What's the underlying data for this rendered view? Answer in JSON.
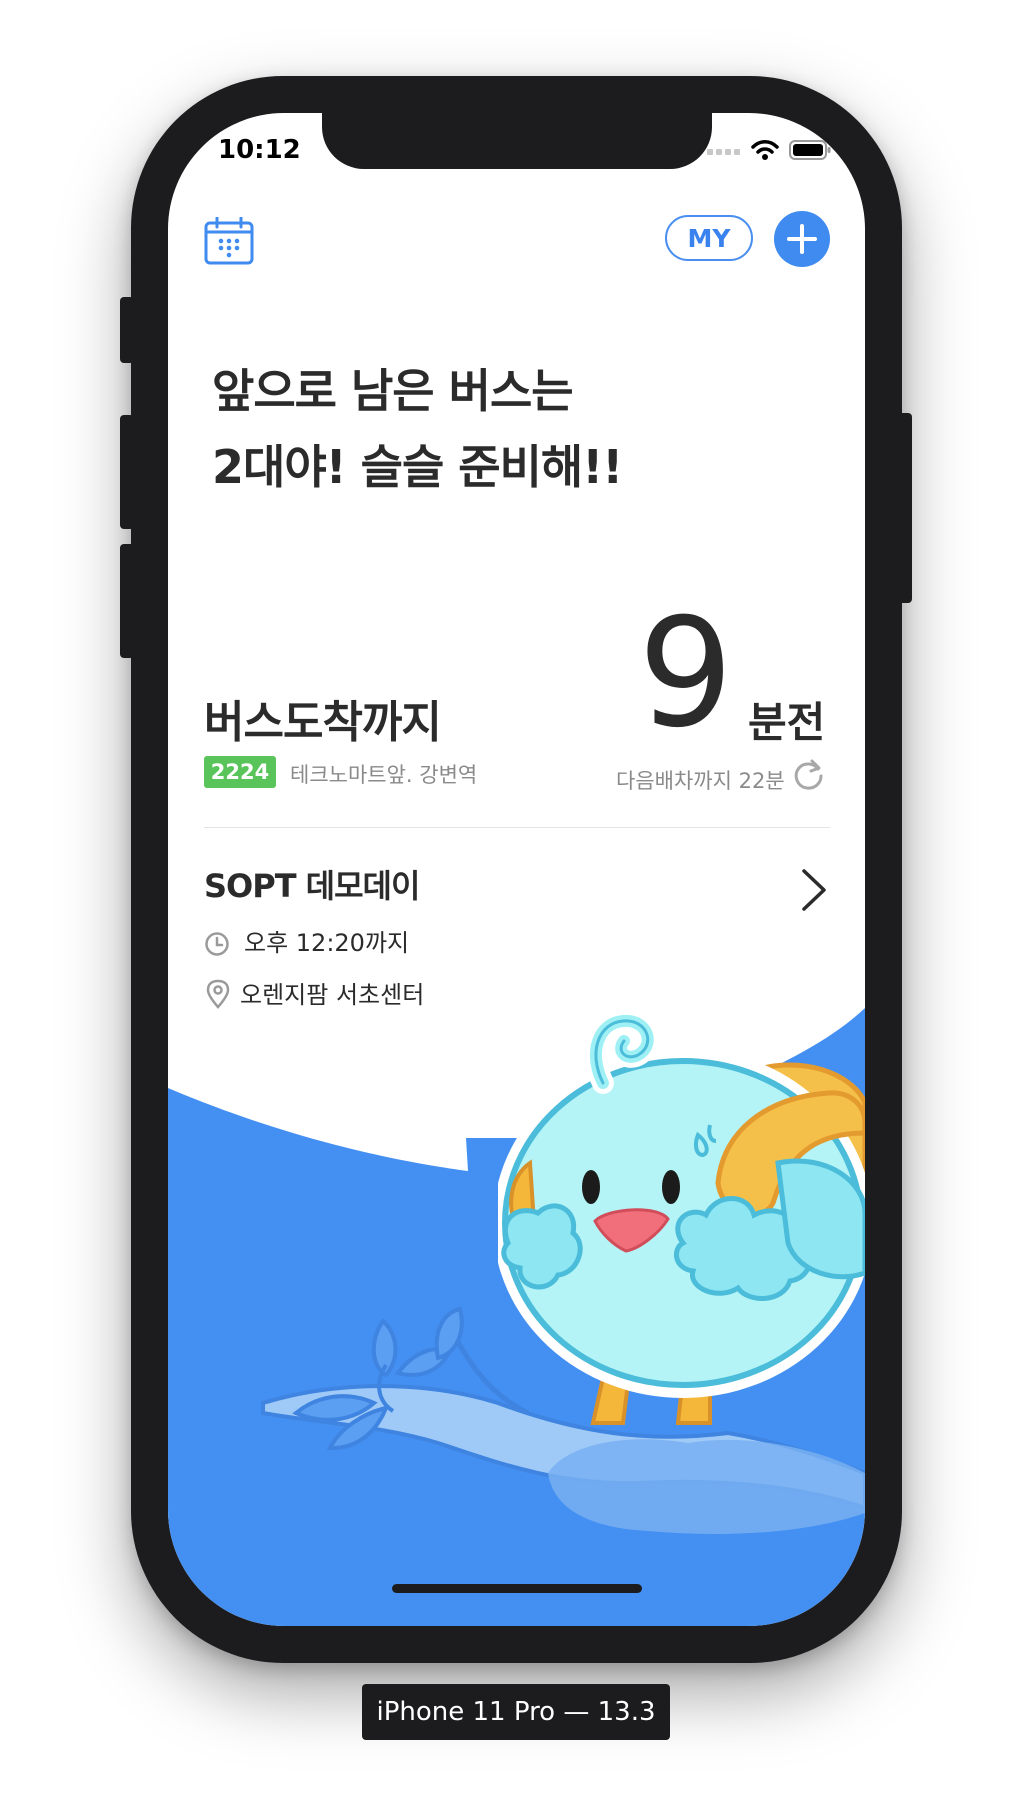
{
  "status_bar": {
    "time": "10:12"
  },
  "header": {
    "my_label": "MY"
  },
  "message": {
    "line1": "앞으로 남은 버스는",
    "line2": "2대야! 슬슬 준비해!!"
  },
  "arrival": {
    "label": "버스도착까지",
    "minutes": "9",
    "unit": "분전",
    "route_number": "2224",
    "stop_name": "테크노마트앞. 강변역",
    "next_dispatch": "다음배차까지 22분"
  },
  "schedule": {
    "title": "SOPT 데모데이",
    "time": "오후 12:20까지",
    "place": "오렌지팜 서초센터"
  },
  "device_label": "iPhone 11 Pro — 13.3",
  "colors": {
    "accent": "#3f8bf0",
    "route_badge": "#58c45a",
    "bird_body": "#b4f4f6",
    "bird_outline": "#4bbcd9",
    "beak": "#f06f7a",
    "wing_yellow": "#f5b73a"
  },
  "icons": [
    "calendar-icon",
    "plus-icon",
    "refresh-icon",
    "chevron-right-icon",
    "clock-icon",
    "location-pin-icon",
    "wifi-icon",
    "battery-icon",
    "cellular-icon"
  ]
}
